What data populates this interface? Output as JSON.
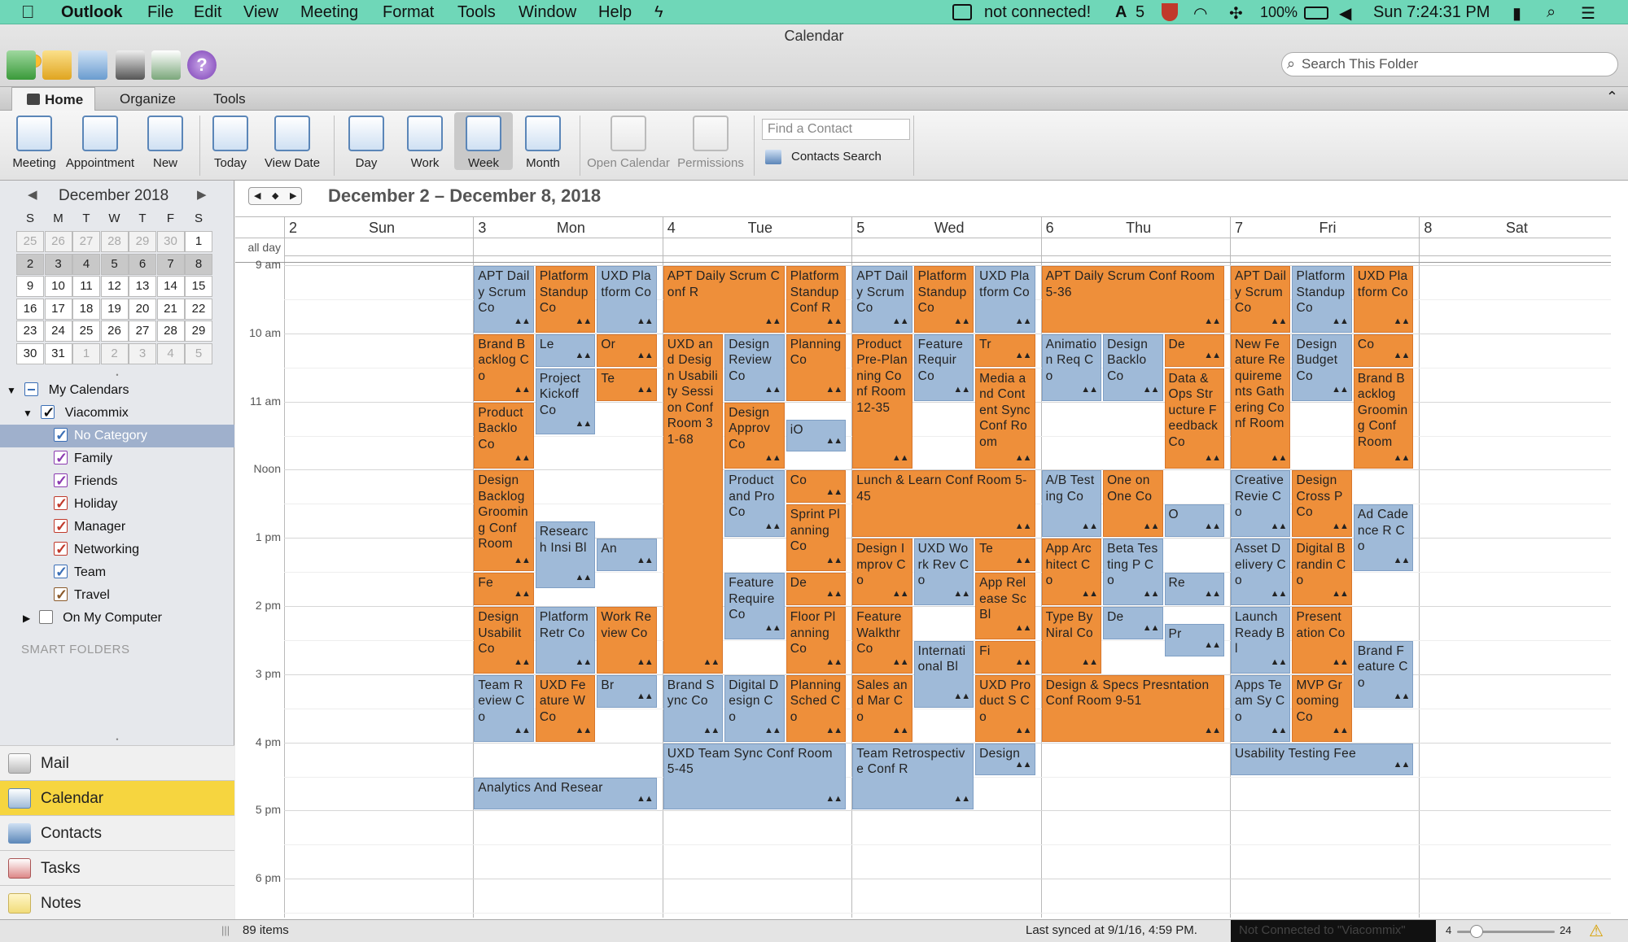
{
  "menubar": {
    "app": "Outlook",
    "items": [
      "File",
      "Edit",
      "View",
      "Meeting",
      "Format",
      "Tools",
      "Window",
      "Help"
    ],
    "status_text": "not connected!",
    "count": "5",
    "battery": "100%",
    "clock": "Sun 7:24:31 PM"
  },
  "window": {
    "title": "Calendar"
  },
  "search": {
    "placeholder": "Search This Folder"
  },
  "tabs": [
    "Home",
    "Organize",
    "Tools"
  ],
  "ribbon": {
    "buttons": [
      "Meeting",
      "Appointment",
      "New",
      "Today",
      "View Date",
      "Day",
      "Work",
      "Week",
      "Month",
      "Open Calendar",
      "Permissions"
    ],
    "find_contact_placeholder": "Find a Contact",
    "contacts_search": "Contacts Search"
  },
  "minical": {
    "title": "December 2018",
    "dow": [
      "S",
      "M",
      "T",
      "W",
      "T",
      "F",
      "S"
    ],
    "weeks": [
      [
        "25",
        "26",
        "27",
        "28",
        "29",
        "30",
        "1"
      ],
      [
        "2",
        "3",
        "4",
        "5",
        "6",
        "7",
        "8"
      ],
      [
        "9",
        "10",
        "11",
        "12",
        "13",
        "14",
        "15"
      ],
      [
        "16",
        "17",
        "18",
        "19",
        "20",
        "21",
        "22"
      ],
      [
        "23",
        "24",
        "25",
        "26",
        "27",
        "28",
        "29"
      ],
      [
        "30",
        "31",
        "1",
        "2",
        "3",
        "4",
        "5"
      ]
    ]
  },
  "tree": {
    "my_calendars": "My Calendars",
    "account": "Viacommix",
    "categories": [
      {
        "label": "No Category",
        "color": "#3b6fb6"
      },
      {
        "label": "Family",
        "color": "#8b3ab0"
      },
      {
        "label": "Friends",
        "color": "#8b3ab0"
      },
      {
        "label": "Holiday",
        "color": "#c0392b"
      },
      {
        "label": "Manager",
        "color": "#c0392b"
      },
      {
        "label": "Networking",
        "color": "#c0392b"
      },
      {
        "label": "Team",
        "color": "#3b6fb6"
      },
      {
        "label": "Travel",
        "color": "#8b5a2b"
      }
    ],
    "on_my_computer": "On My Computer",
    "smart_folders": "SMART FOLDERS"
  },
  "nav": [
    "Mail",
    "Calendar",
    "Contacts",
    "Tasks",
    "Notes"
  ],
  "calendar": {
    "range_title": "December 2 – December 8, 2018",
    "days": [
      {
        "num": "2",
        "name": "Sun"
      },
      {
        "num": "3",
        "name": "Mon"
      },
      {
        "num": "4",
        "name": "Tue"
      },
      {
        "num": "5",
        "name": "Wed"
      },
      {
        "num": "6",
        "name": "Thu"
      },
      {
        "num": "7",
        "name": "Fri"
      },
      {
        "num": "8",
        "name": "Sat"
      }
    ],
    "allday_label": "all day",
    "hours": [
      "9 am",
      "10 am",
      "11 am",
      "Noon",
      "1 pm",
      "2 pm",
      "3 pm",
      "4 pm",
      "5 pm",
      "6 pm"
    ]
  },
  "events": [
    {
      "d": 1,
      "s": 9,
      "e": 10,
      "c": 0,
      "n": 3,
      "t": "APT Daily Scrum Co",
      "k": "b"
    },
    {
      "d": 1,
      "s": 9,
      "e": 10,
      "c": 1,
      "n": 3,
      "t": "Platform Standup Co",
      "k": "o"
    },
    {
      "d": 1,
      "s": 9,
      "e": 10,
      "c": 2,
      "n": 3,
      "t": "UXD Platform Co",
      "k": "b"
    },
    {
      "d": 1,
      "s": 10,
      "e": 11,
      "c": 0,
      "n": 3,
      "t": "Brand Backlog Co",
      "k": "o"
    },
    {
      "d": 1,
      "s": 10,
      "e": 10.5,
      "c": 1,
      "n": 3,
      "t": "Le",
      "k": "b"
    },
    {
      "d": 1,
      "s": 10,
      "e": 10.5,
      "c": 2,
      "n": 3,
      "t": "Or",
      "k": "o"
    },
    {
      "d": 1,
      "s": 10.5,
      "e": 11.5,
      "c": 1,
      "n": 3,
      "t": "Project Kickoff Co",
      "k": "b"
    },
    {
      "d": 1,
      "s": 10.5,
      "e": 11,
      "c": 2,
      "n": 3,
      "t": "Te",
      "k": "o"
    },
    {
      "d": 1,
      "s": 11,
      "e": 12,
      "c": 0,
      "n": 3,
      "t": "Product Backlo Co",
      "k": "o"
    },
    {
      "d": 1,
      "s": 12,
      "e": 13.5,
      "c": 0,
      "n": 3,
      "t": "Design Backlog Grooming Conf Room",
      "k": "o"
    },
    {
      "d": 1,
      "s": 12.75,
      "e": 13.75,
      "c": 1,
      "n": 3,
      "t": "Research Insi Bl",
      "k": "b"
    },
    {
      "d": 1,
      "s": 13,
      "e": 13.5,
      "c": 2,
      "n": 3,
      "t": "An",
      "k": "b"
    },
    {
      "d": 1,
      "s": 13.5,
      "e": 14,
      "c": 0,
      "n": 3,
      "t": "Fe",
      "k": "o"
    },
    {
      "d": 1,
      "s": 14,
      "e": 15,
      "c": 0,
      "n": 3,
      "t": "Design Usabilit Co",
      "k": "o"
    },
    {
      "d": 1,
      "s": 14,
      "e": 15,
      "c": 1,
      "n": 3,
      "t": "Platform Retr Co",
      "k": "b"
    },
    {
      "d": 1,
      "s": 14,
      "e": 15,
      "c": 2,
      "n": 3,
      "t": "Work Review Co",
      "k": "o"
    },
    {
      "d": 1,
      "s": 15,
      "e": 16,
      "c": 0,
      "n": 3,
      "t": "Team Review Co",
      "k": "b"
    },
    {
      "d": 1,
      "s": 15,
      "e": 16,
      "c": 1,
      "n": 3,
      "t": "UXD Feature W Co",
      "k": "o"
    },
    {
      "d": 1,
      "s": 15,
      "e": 15.5,
      "c": 2,
      "n": 3,
      "t": "Br",
      "k": "b"
    },
    {
      "d": 1,
      "s": 16.5,
      "e": 17,
      "c": 0,
      "n": 1,
      "t": "Analytics And Resear",
      "k": "b"
    },
    {
      "d": 2,
      "s": 9,
      "e": 10,
      "c": 0,
      "n": 2,
      "t": "APT Daily Scrum Conf R",
      "k": "o"
    },
    {
      "d": 2,
      "s": 9,
      "e": 10,
      "c": 1,
      "n": 2,
      "t": "Platform Standup Conf R",
      "k": "o"
    },
    {
      "d": 2,
      "s": 10,
      "e": 15,
      "c": 0,
      "n": 3,
      "t": "UXD and Design Usability Session Conf Room 31-68",
      "k": "o"
    },
    {
      "d": 2,
      "s": 10,
      "e": 11,
      "c": 1,
      "n": 3,
      "t": "Design Review Co",
      "k": "b"
    },
    {
      "d": 2,
      "s": 10,
      "e": 11,
      "c": 2,
      "n": 3,
      "t": "Planning Co",
      "k": "o"
    },
    {
      "d": 2,
      "s": 11,
      "e": 12,
      "c": 1,
      "n": 3,
      "t": "Design Approv Co",
      "k": "o"
    },
    {
      "d": 2,
      "s": 11.25,
      "e": 11.75,
      "c": 2,
      "n": 3,
      "t": "iO",
      "k": "b"
    },
    {
      "d": 2,
      "s": 12,
      "e": 13,
      "c": 1,
      "n": 3,
      "t": "Product and Pro Co",
      "k": "b"
    },
    {
      "d": 2,
      "s": 12,
      "e": 12.5,
      "c": 2,
      "n": 3,
      "t": "Co",
      "k": "o"
    },
    {
      "d": 2,
      "s": 12.5,
      "e": 13.5,
      "c": 2,
      "n": 3,
      "t": "Sprint Planning Co",
      "k": "o"
    },
    {
      "d": 2,
      "s": 13.5,
      "e": 14.5,
      "c": 1,
      "n": 3,
      "t": "Feature Require Co",
      "k": "b"
    },
    {
      "d": 2,
      "s": 13.5,
      "e": 14,
      "c": 2,
      "n": 3,
      "t": "De",
      "k": "o"
    },
    {
      "d": 2,
      "s": 14,
      "e": 15,
      "c": 2,
      "n": 3,
      "t": "Floor Planning Co",
      "k": "o"
    },
    {
      "d": 2,
      "s": 15,
      "e": 16,
      "c": 0,
      "n": 3,
      "t": "Brand Sync Co",
      "k": "b"
    },
    {
      "d": 2,
      "s": 15,
      "e": 16,
      "c": 1,
      "n": 3,
      "t": "Digital Design Co",
      "k": "b"
    },
    {
      "d": 2,
      "s": 15,
      "e": 16,
      "c": 2,
      "n": 3,
      "t": "Planning Sched Co",
      "k": "o"
    },
    {
      "d": 2,
      "s": 16,
      "e": 17,
      "c": 0,
      "n": 1,
      "t": "UXD Team Sync Conf Room 5-45",
      "k": "b"
    },
    {
      "d": 3,
      "s": 9,
      "e": 10,
      "c": 0,
      "n": 3,
      "t": "APT Daily Scrum Co",
      "k": "b"
    },
    {
      "d": 3,
      "s": 9,
      "e": 10,
      "c": 1,
      "n": 3,
      "t": "Platform Standup Co",
      "k": "o"
    },
    {
      "d": 3,
      "s": 9,
      "e": 10,
      "c": 2,
      "n": 3,
      "t": "UXD Platform Co",
      "k": "b"
    },
    {
      "d": 3,
      "s": 10,
      "e": 12,
      "c": 0,
      "n": 3,
      "t": "Product Pre-Planning Conf Room 12-35",
      "k": "o"
    },
    {
      "d": 3,
      "s": 10,
      "e": 11,
      "c": 1,
      "n": 3,
      "t": "Feature Requir Co",
      "k": "b"
    },
    {
      "d": 3,
      "s": 10,
      "e": 10.5,
      "c": 2,
      "n": 3,
      "t": "Tr",
      "k": "o"
    },
    {
      "d": 3,
      "s": 10.5,
      "e": 12,
      "c": 2,
      "n": 3,
      "t": "Media and Content Sync Conf Room",
      "k": "o"
    },
    {
      "d": 3,
      "s": 12,
      "e": 13,
      "c": 0,
      "n": 1,
      "t": "Lunch & Learn Conf Room 5-45",
      "k": "o"
    },
    {
      "d": 3,
      "s": 13,
      "e": 14,
      "c": 0,
      "n": 3,
      "t": "Design Improv Co",
      "k": "o"
    },
    {
      "d": 3,
      "s": 13,
      "e": 14,
      "c": 1,
      "n": 3,
      "t": "UXD Work Rev Co",
      "k": "b"
    },
    {
      "d": 3,
      "s": 13,
      "e": 13.5,
      "c": 2,
      "n": 3,
      "t": "Te",
      "k": "o"
    },
    {
      "d": 3,
      "s": 13.5,
      "e": 14.5,
      "c": 2,
      "n": 3,
      "t": "App Release Sc Bl",
      "k": "o"
    },
    {
      "d": 3,
      "s": 14,
      "e": 15,
      "c": 0,
      "n": 3,
      "t": "Feature Walkthr Co",
      "k": "o"
    },
    {
      "d": 3,
      "s": 14.5,
      "e": 15.5,
      "c": 1,
      "n": 3,
      "t": "International Bl",
      "k": "b"
    },
    {
      "d": 3,
      "s": 14.5,
      "e": 15,
      "c": 2,
      "n": 3,
      "t": "Fi",
      "k": "o"
    },
    {
      "d": 3,
      "s": 15,
      "e": 16,
      "c": 0,
      "n": 3,
      "t": "Sales and Mar Co",
      "k": "o"
    },
    {
      "d": 3,
      "s": 15,
      "e": 16,
      "c": 2,
      "n": 3,
      "t": "UXD Product S Co",
      "k": "o"
    },
    {
      "d": 3,
      "s": 16,
      "e": 17,
      "c": 0,
      "n": 2,
      "t": "Team Retrospective Conf R",
      "k": "b"
    },
    {
      "d": 3,
      "s": 16,
      "e": 16.5,
      "c": 1,
      "n": 2,
      "t": "Design",
      "k": "b"
    },
    {
      "d": 4,
      "s": 9,
      "e": 10,
      "c": 0,
      "n": 1,
      "t": "APT Daily Scrum Conf Room 5-36",
      "k": "o"
    },
    {
      "d": 4,
      "s": 10,
      "e": 11,
      "c": 0,
      "n": 3,
      "t": "Animation Req Co",
      "k": "b"
    },
    {
      "d": 4,
      "s": 10,
      "e": 11,
      "c": 1,
      "n": 3,
      "t": "Design Backlo Co",
      "k": "b"
    },
    {
      "d": 4,
      "s": 10,
      "e": 10.5,
      "c": 2,
      "n": 3,
      "t": "De",
      "k": "o"
    },
    {
      "d": 4,
      "s": 10.5,
      "e": 12,
      "c": 2,
      "n": 3,
      "t": "Data & Ops Structure Feedback Co",
      "k": "o"
    },
    {
      "d": 4,
      "s": 12,
      "e": 13,
      "c": 0,
      "n": 3,
      "t": "A/B Testing Co",
      "k": "b"
    },
    {
      "d": 4,
      "s": 12,
      "e": 13,
      "c": 1,
      "n": 3,
      "t": "One on One Co",
      "k": "o"
    },
    {
      "d": 4,
      "s": 12.5,
      "e": 13,
      "c": 2,
      "n": 3,
      "t": "O",
      "k": "b"
    },
    {
      "d": 4,
      "s": 13,
      "e": 14,
      "c": 0,
      "n": 3,
      "t": "App Architect Co",
      "k": "o"
    },
    {
      "d": 4,
      "s": 13,
      "e": 14,
      "c": 1,
      "n": 3,
      "t": "Beta Testing P Co",
      "k": "b"
    },
    {
      "d": 4,
      "s": 13.5,
      "e": 14,
      "c": 2,
      "n": 3,
      "t": "Re",
      "k": "b"
    },
    {
      "d": 4,
      "s": 14,
      "e": 15,
      "c": 0,
      "n": 3,
      "t": "Type By Niral Co",
      "k": "o"
    },
    {
      "d": 4,
      "s": 14,
      "e": 14.5,
      "c": 1,
      "n": 3,
      "t": "De",
      "k": "b"
    },
    {
      "d": 4,
      "s": 14.25,
      "e": 14.75,
      "c": 2,
      "n": 3,
      "t": "Pr",
      "k": "b"
    },
    {
      "d": 4,
      "s": 15,
      "e": 16,
      "c": 0,
      "n": 1,
      "t": "Design & Specs Presntation Conf Room 9-51",
      "k": "o"
    },
    {
      "d": 5,
      "s": 9,
      "e": 10,
      "c": 0,
      "n": 3,
      "t": "APT Daily Scrum Co",
      "k": "o"
    },
    {
      "d": 5,
      "s": 9,
      "e": 10,
      "c": 1,
      "n": 3,
      "t": "Platform Standup Co",
      "k": "b"
    },
    {
      "d": 5,
      "s": 9,
      "e": 10,
      "c": 2,
      "n": 3,
      "t": "UXD Platform Co",
      "k": "o"
    },
    {
      "d": 5,
      "s": 10,
      "e": 12,
      "c": 0,
      "n": 3,
      "t": "New Feature Requirements Gathering Conf Room",
      "k": "o"
    },
    {
      "d": 5,
      "s": 10,
      "e": 11,
      "c": 1,
      "n": 3,
      "t": "Design Budget Co",
      "k": "b"
    },
    {
      "d": 5,
      "s": 10,
      "e": 10.5,
      "c": 2,
      "n": 3,
      "t": "Co",
      "k": "o"
    },
    {
      "d": 5,
      "s": 10.5,
      "e": 12,
      "c": 2,
      "n": 3,
      "t": "Brand Backlog Grooming Conf Room",
      "k": "o"
    },
    {
      "d": 5,
      "s": 12,
      "e": 13,
      "c": 0,
      "n": 3,
      "t": "Creative Revie Co",
      "k": "b"
    },
    {
      "d": 5,
      "s": 12,
      "e": 13,
      "c": 1,
      "n": 3,
      "t": "Design Cross P Co",
      "k": "o"
    },
    {
      "d": 5,
      "s": 12.5,
      "e": 13.5,
      "c": 2,
      "n": 3,
      "t": "Ad Cadence R Co",
      "k": "b"
    },
    {
      "d": 5,
      "s": 13,
      "e": 14,
      "c": 0,
      "n": 3,
      "t": "Asset Delivery Co",
      "k": "b"
    },
    {
      "d": 5,
      "s": 13,
      "e": 14,
      "c": 1,
      "n": 3,
      "t": "Digital Brandin Co",
      "k": "o"
    },
    {
      "d": 5,
      "s": 14,
      "e": 15,
      "c": 0,
      "n": 3,
      "t": "Launch Ready Bl",
      "k": "b"
    },
    {
      "d": 5,
      "s": 14,
      "e": 15,
      "c": 1,
      "n": 3,
      "t": "Presentation Co",
      "k": "o"
    },
    {
      "d": 5,
      "s": 14.5,
      "e": 15.5,
      "c": 2,
      "n": 3,
      "t": "Brand Feature Co",
      "k": "b"
    },
    {
      "d": 5,
      "s": 15,
      "e": 16,
      "c": 0,
      "n": 3,
      "t": "Apps Team Sy Co",
      "k": "b"
    },
    {
      "d": 5,
      "s": 15,
      "e": 16,
      "c": 1,
      "n": 3,
      "t": "MVP Grooming Co",
      "k": "o"
    },
    {
      "d": 5,
      "s": 16,
      "e": 16.5,
      "c": 0,
      "n": 1,
      "t": "Usability Testing Fee",
      "k": "b"
    }
  ],
  "status": {
    "items": "89 items",
    "synced": "Last synced at 9/1/16, 4:59 PM.",
    "conn": "Not Connected to \"Viacommix\"",
    "zoom_min": "4",
    "zoom_max": "24",
    "zoom_level": 0.15
  }
}
